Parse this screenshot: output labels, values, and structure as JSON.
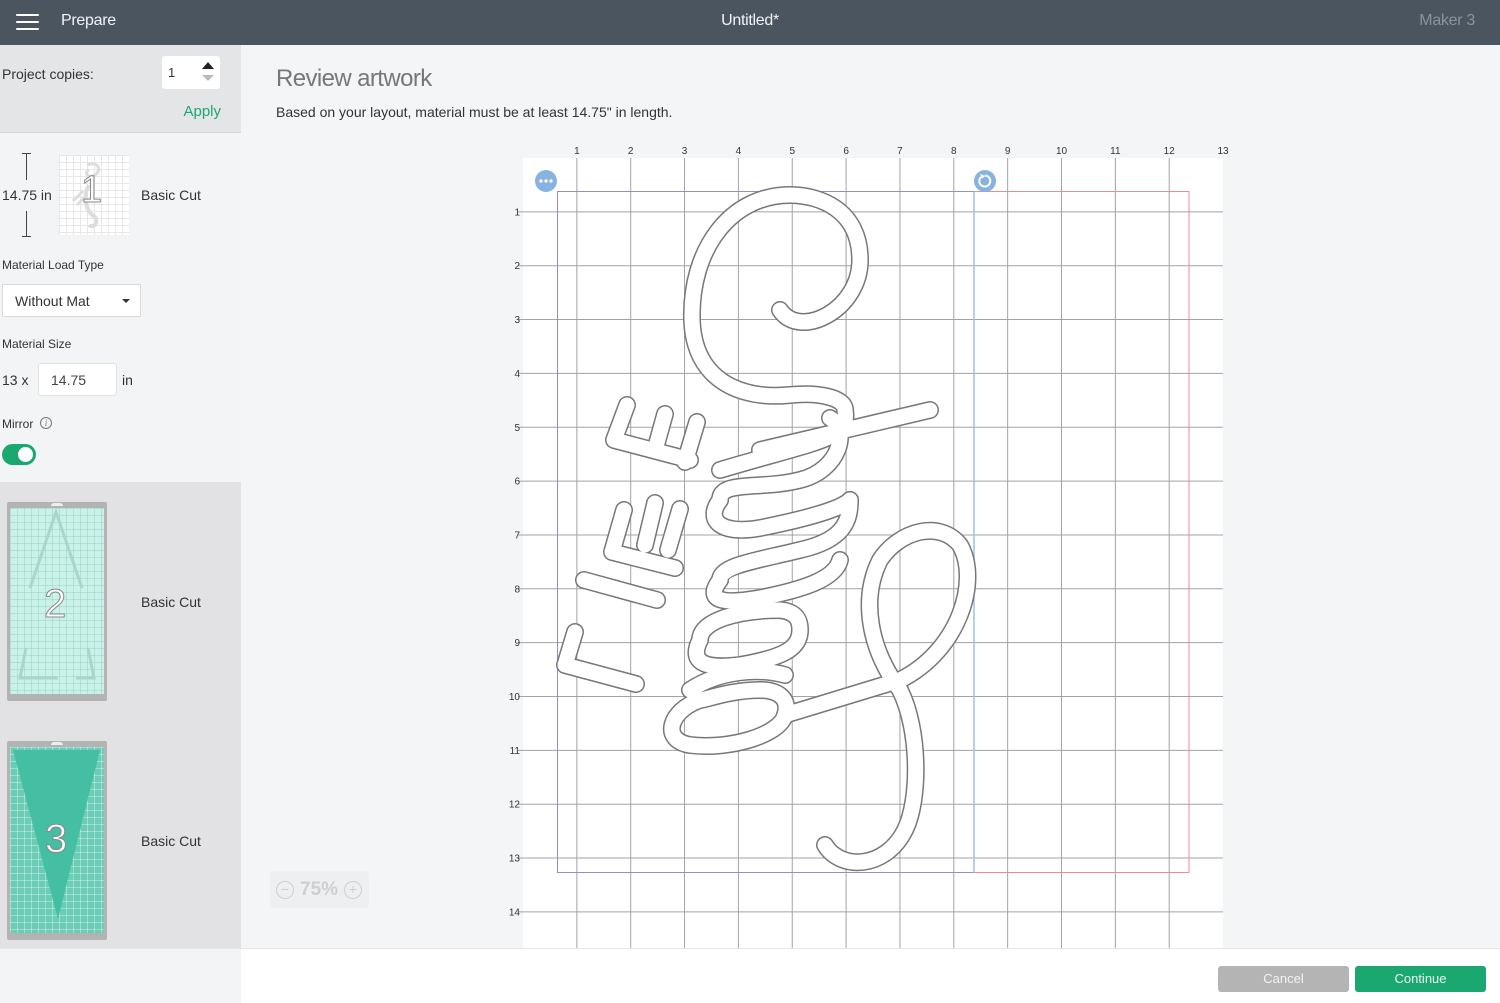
{
  "header": {
    "menu_icon": "hamburger-icon",
    "section_title": "Prepare",
    "document_title": "Untitled*",
    "machine_name": "Maker 3"
  },
  "sidebar": {
    "project_copies": {
      "label": "Project copies:",
      "value": "1",
      "apply_label": "Apply"
    },
    "mats": [
      {
        "number": "1",
        "label": "Basic Cut",
        "length_label": "14.75 in",
        "color": "#ffffff"
      },
      {
        "number": "2",
        "label": "Basic Cut",
        "color": "#c9f3e9"
      },
      {
        "number": "3",
        "label": "Basic Cut",
        "color": "#4fc2a8"
      }
    ],
    "material_load_type": {
      "label": "Material Load Type",
      "selected": "Without Mat"
    },
    "material_size": {
      "label": "Material Size",
      "width_prefix": "13 x",
      "length_value": "14.75",
      "unit": "in"
    },
    "mirror": {
      "label": "Mirror",
      "info_icon": "info-icon",
      "enabled": true
    }
  },
  "main": {
    "title": "Review artwork",
    "subtitle": "Based on your layout, material must be at least 14.75\" in length.",
    "zoom": {
      "value": "75%",
      "zoom_out_icon": "minus-circle-icon",
      "zoom_in_icon": "plus-circle-icon"
    },
    "canvas": {
      "top_ruler": [
        "1",
        "2",
        "3",
        "4",
        "5",
        "6",
        "7",
        "8",
        "9",
        "10",
        "11",
        "12",
        "13"
      ],
      "left_ruler": [
        "1",
        "2",
        "3",
        "4",
        "5",
        "6",
        "7",
        "8",
        "9",
        "10",
        "11",
        "12",
        "13",
        "14"
      ],
      "more_options_icon": "more-options-icon",
      "rotate_icon": "rotate-icon",
      "selection_color": "#8e8fce",
      "material_bound_color": "#ee8a96"
    }
  },
  "footer": {
    "cancel_label": "Cancel",
    "continue_label": "Continue"
  },
  "colors": {
    "accent": "#1aa870",
    "header": "#4b555f"
  }
}
